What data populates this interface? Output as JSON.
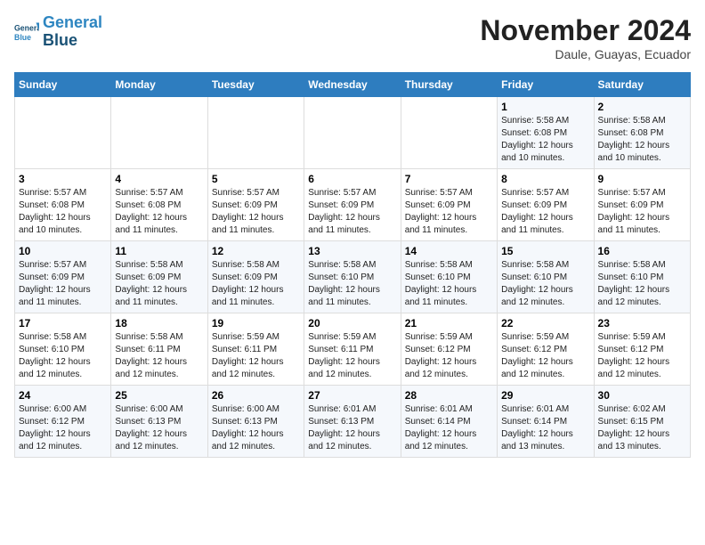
{
  "header": {
    "logo_line1": "General",
    "logo_line2": "Blue",
    "month": "November 2024",
    "location": "Daule, Guayas, Ecuador"
  },
  "weekdays": [
    "Sunday",
    "Monday",
    "Tuesday",
    "Wednesday",
    "Thursday",
    "Friday",
    "Saturday"
  ],
  "weeks": [
    [
      {
        "day": "",
        "info": ""
      },
      {
        "day": "",
        "info": ""
      },
      {
        "day": "",
        "info": ""
      },
      {
        "day": "",
        "info": ""
      },
      {
        "day": "",
        "info": ""
      },
      {
        "day": "1",
        "info": "Sunrise: 5:58 AM\nSunset: 6:08 PM\nDaylight: 12 hours\nand 10 minutes."
      },
      {
        "day": "2",
        "info": "Sunrise: 5:58 AM\nSunset: 6:08 PM\nDaylight: 12 hours\nand 10 minutes."
      }
    ],
    [
      {
        "day": "3",
        "info": "Sunrise: 5:57 AM\nSunset: 6:08 PM\nDaylight: 12 hours\nand 10 minutes."
      },
      {
        "day": "4",
        "info": "Sunrise: 5:57 AM\nSunset: 6:08 PM\nDaylight: 12 hours\nand 11 minutes."
      },
      {
        "day": "5",
        "info": "Sunrise: 5:57 AM\nSunset: 6:09 PM\nDaylight: 12 hours\nand 11 minutes."
      },
      {
        "day": "6",
        "info": "Sunrise: 5:57 AM\nSunset: 6:09 PM\nDaylight: 12 hours\nand 11 minutes."
      },
      {
        "day": "7",
        "info": "Sunrise: 5:57 AM\nSunset: 6:09 PM\nDaylight: 12 hours\nand 11 minutes."
      },
      {
        "day": "8",
        "info": "Sunrise: 5:57 AM\nSunset: 6:09 PM\nDaylight: 12 hours\nand 11 minutes."
      },
      {
        "day": "9",
        "info": "Sunrise: 5:57 AM\nSunset: 6:09 PM\nDaylight: 12 hours\nand 11 minutes."
      }
    ],
    [
      {
        "day": "10",
        "info": "Sunrise: 5:57 AM\nSunset: 6:09 PM\nDaylight: 12 hours\nand 11 minutes."
      },
      {
        "day": "11",
        "info": "Sunrise: 5:58 AM\nSunset: 6:09 PM\nDaylight: 12 hours\nand 11 minutes."
      },
      {
        "day": "12",
        "info": "Sunrise: 5:58 AM\nSunset: 6:09 PM\nDaylight: 12 hours\nand 11 minutes."
      },
      {
        "day": "13",
        "info": "Sunrise: 5:58 AM\nSunset: 6:10 PM\nDaylight: 12 hours\nand 11 minutes."
      },
      {
        "day": "14",
        "info": "Sunrise: 5:58 AM\nSunset: 6:10 PM\nDaylight: 12 hours\nand 11 minutes."
      },
      {
        "day": "15",
        "info": "Sunrise: 5:58 AM\nSunset: 6:10 PM\nDaylight: 12 hours\nand 12 minutes."
      },
      {
        "day": "16",
        "info": "Sunrise: 5:58 AM\nSunset: 6:10 PM\nDaylight: 12 hours\nand 12 minutes."
      }
    ],
    [
      {
        "day": "17",
        "info": "Sunrise: 5:58 AM\nSunset: 6:10 PM\nDaylight: 12 hours\nand 12 minutes."
      },
      {
        "day": "18",
        "info": "Sunrise: 5:58 AM\nSunset: 6:11 PM\nDaylight: 12 hours\nand 12 minutes."
      },
      {
        "day": "19",
        "info": "Sunrise: 5:59 AM\nSunset: 6:11 PM\nDaylight: 12 hours\nand 12 minutes."
      },
      {
        "day": "20",
        "info": "Sunrise: 5:59 AM\nSunset: 6:11 PM\nDaylight: 12 hours\nand 12 minutes."
      },
      {
        "day": "21",
        "info": "Sunrise: 5:59 AM\nSunset: 6:12 PM\nDaylight: 12 hours\nand 12 minutes."
      },
      {
        "day": "22",
        "info": "Sunrise: 5:59 AM\nSunset: 6:12 PM\nDaylight: 12 hours\nand 12 minutes."
      },
      {
        "day": "23",
        "info": "Sunrise: 5:59 AM\nSunset: 6:12 PM\nDaylight: 12 hours\nand 12 minutes."
      }
    ],
    [
      {
        "day": "24",
        "info": "Sunrise: 6:00 AM\nSunset: 6:12 PM\nDaylight: 12 hours\nand 12 minutes."
      },
      {
        "day": "25",
        "info": "Sunrise: 6:00 AM\nSunset: 6:13 PM\nDaylight: 12 hours\nand 12 minutes."
      },
      {
        "day": "26",
        "info": "Sunrise: 6:00 AM\nSunset: 6:13 PM\nDaylight: 12 hours\nand 12 minutes."
      },
      {
        "day": "27",
        "info": "Sunrise: 6:01 AM\nSunset: 6:13 PM\nDaylight: 12 hours\nand 12 minutes."
      },
      {
        "day": "28",
        "info": "Sunrise: 6:01 AM\nSunset: 6:14 PM\nDaylight: 12 hours\nand 12 minutes."
      },
      {
        "day": "29",
        "info": "Sunrise: 6:01 AM\nSunset: 6:14 PM\nDaylight: 12 hours\nand 13 minutes."
      },
      {
        "day": "30",
        "info": "Sunrise: 6:02 AM\nSunset: 6:15 PM\nDaylight: 12 hours\nand 13 minutes."
      }
    ]
  ]
}
